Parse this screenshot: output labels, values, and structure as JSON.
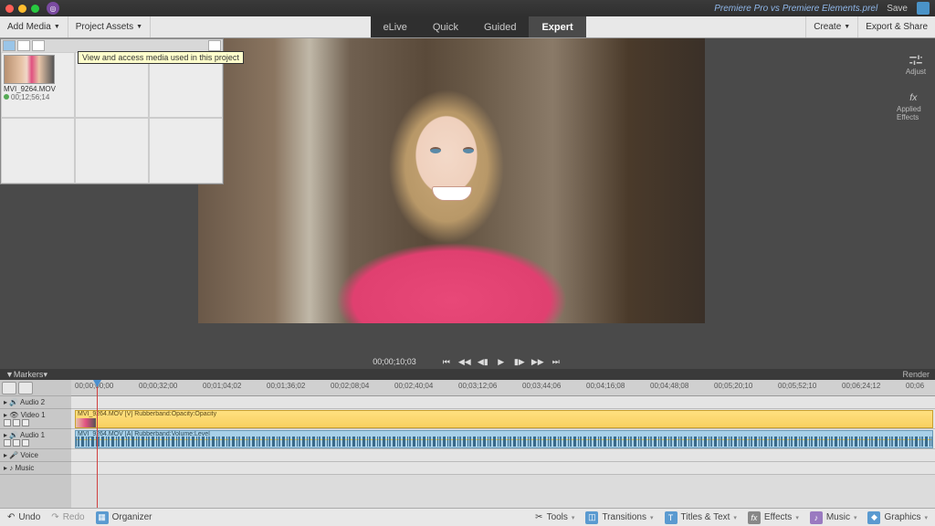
{
  "titlebar": {
    "project_name": "Premiere Pro vs Premiere Elements.prel",
    "save": "Save"
  },
  "menubar": {
    "add_media": "Add Media",
    "project_assets": "Project Assets",
    "modes": [
      "eLive",
      "Quick",
      "Guided",
      "Expert"
    ],
    "active_mode": "Expert",
    "create": "Create",
    "export_share": "Export & Share"
  },
  "tooltip": "View and access media used in this project",
  "asset": {
    "name": "MVI_9264.MOV",
    "duration": "00;12;56;14"
  },
  "side_panel": {
    "adjust": "Adjust",
    "applied_effects": "Applied Effects"
  },
  "transport": {
    "timecode": "00;00;10;03"
  },
  "timeline": {
    "markers": "Markers",
    "render": "Render",
    "ruler": [
      "00;00;00;00",
      "00;00;32;00",
      "00;01;04;02",
      "00;01;36;02",
      "00;02;08;04",
      "00;02;40;04",
      "00;03;12;06",
      "00;03;44;06",
      "00;04;16;08",
      "00;04;48;08",
      "00;05;20;10",
      "00;05;52;10",
      "00;06;24;12",
      "00;06"
    ],
    "tracks": {
      "audio2": "Audio 2",
      "video1": "Video 1",
      "audio1": "Audio 1",
      "voice": "Voice",
      "music": "Music"
    },
    "clip_video_label": "MVI_9264.MOV [V] Rubberband:Opacity:Opacity",
    "clip_audio_label": "MVI_9264.MOV [A] Rubberband:Volume:Level"
  },
  "bottombar": {
    "undo": "Undo",
    "redo": "Redo",
    "organizer": "Organizer",
    "tools": "Tools",
    "transitions": "Transitions",
    "titles": "Titles & Text",
    "effects": "Effects",
    "music": "Music",
    "graphics": "Graphics"
  }
}
